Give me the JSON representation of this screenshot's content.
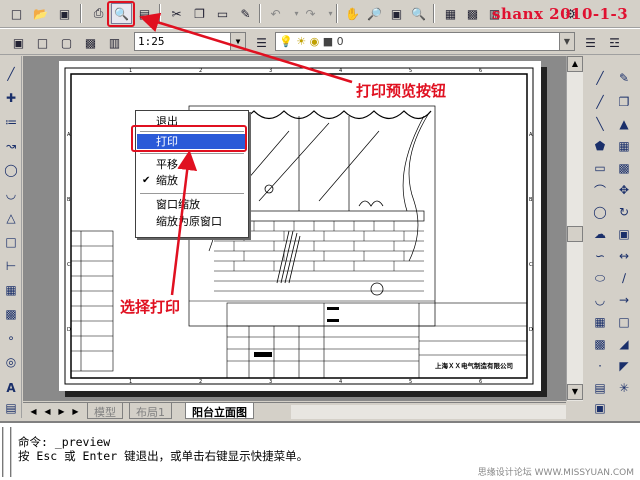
{
  "toolbar_standard": {
    "items": [
      "new",
      "open",
      "save",
      "print",
      "print-preview",
      "publish",
      "cut",
      "copy",
      "paste",
      "match-properties",
      "undo",
      "redo",
      "pan",
      "zoom-realtime",
      "zoom-window",
      "zoom-previous",
      "properties",
      "design-center",
      "tool-palettes"
    ]
  },
  "watermark_text": "shanx 2010-1-3",
  "toolbar_layout": {
    "scale_value": "1:25",
    "layer_value": "0"
  },
  "canvas": {
    "drawing_title_block_text": "上海ＸＸ电气制造有限公司"
  },
  "context_menu": {
    "items": [
      {
        "label": "退出",
        "selected": false,
        "checked": false
      },
      {
        "label": "打印",
        "selected": true,
        "checked": false
      },
      {
        "label": "平移",
        "selected": false,
        "checked": false
      },
      {
        "label": "缩放",
        "selected": false,
        "checked": true
      },
      {
        "label": "窗口缩放",
        "selected": false,
        "checked": false
      },
      {
        "label": "缩放为原窗口",
        "selected": false,
        "checked": false
      }
    ]
  },
  "layout_tabs": {
    "tabs": [
      "模型",
      "布局1",
      "阳台立面图"
    ],
    "active": "阳台立面图"
  },
  "command_line": {
    "line1": "命令: _preview",
    "line2": "按 Esc 或 Enter 键退出，或单击右键显示快捷菜单。",
    "site_watermark": "思缘设计论坛 WWW.MISSYUAN.COM"
  },
  "annotations": {
    "preview_button_callout": "打印预览按钮",
    "select_print_callout": "选择打印",
    "color": "#e01020"
  }
}
